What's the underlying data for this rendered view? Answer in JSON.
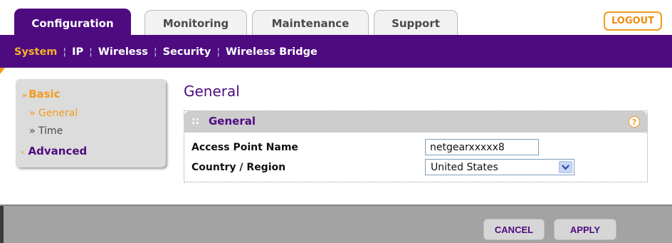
{
  "tabs": [
    {
      "label": "Configuration",
      "active": true
    },
    {
      "label": "Monitoring",
      "active": false
    },
    {
      "label": "Maintenance",
      "active": false
    },
    {
      "label": "Support",
      "active": false
    }
  ],
  "logout_label": "LOGOUT",
  "subnav": {
    "items": [
      "System",
      "IP",
      "Wireless",
      "Security",
      "Wireless Bridge"
    ],
    "active": "System"
  },
  "left_menu": {
    "basic": "Basic",
    "general": "General",
    "time": "Time",
    "advanced": "Advanced"
  },
  "page_title": "General",
  "panel": {
    "title": "General",
    "dots": "::",
    "help": "?",
    "ap_name_label": "Access Point Name",
    "ap_name_value": "netgearxxxxx8",
    "country_label": "Country / Region",
    "country_value": "United States"
  },
  "buttons": {
    "cancel": "CANCEL",
    "apply": "APPLY"
  },
  "colors": {
    "accent_purple": "#4e0b80",
    "accent_orange": "#f39a1e"
  },
  "icons": {
    "chevron_down": "chevron-down-icon",
    "help": "help-icon",
    "expand_arrow": "double-arrow-icon"
  }
}
